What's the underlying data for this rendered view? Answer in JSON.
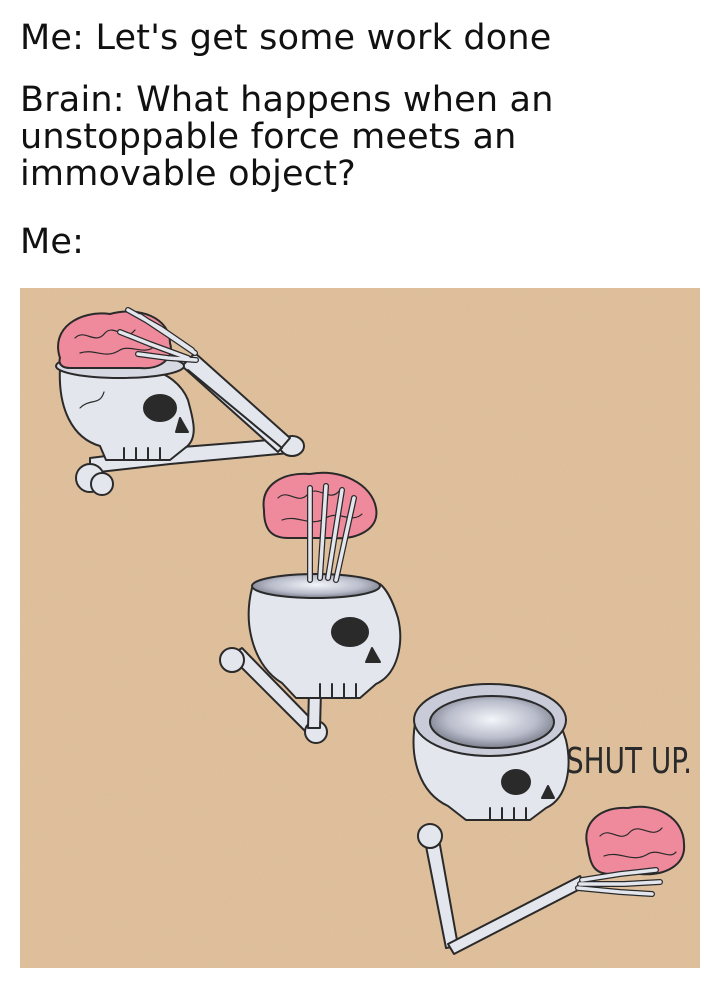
{
  "captions": {
    "line1": "Me: Let's get some work done",
    "line2": "Brain: What happens when an unstoppable force meets an immovable object?",
    "line3": "Me:"
  },
  "panel": {
    "speech": "SHUT UP."
  },
  "colors": {
    "background_paper": "#e2c29e",
    "brain_pink": "#ee8a9c",
    "bone": "#e4e6ee",
    "outline": "#2a2a2a",
    "text": "#111111"
  },
  "icons": [
    "skull-icon",
    "brain-icon",
    "bone-hand-icon"
  ]
}
